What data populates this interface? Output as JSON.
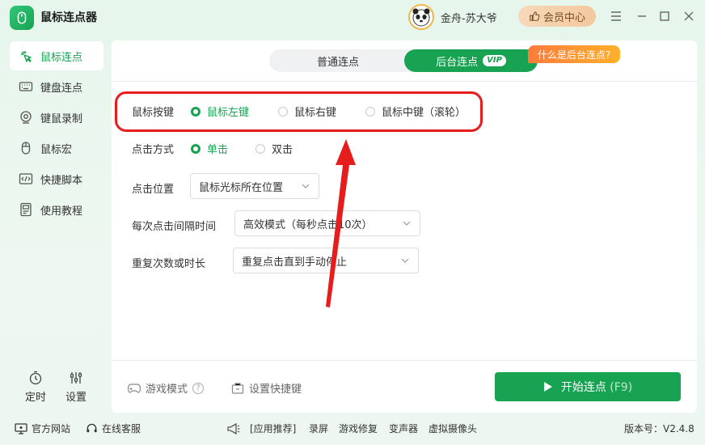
{
  "app": {
    "title": "鼠标连点器",
    "username": "金舟-苏大爷",
    "member_label": "会员中心"
  },
  "sidebar": {
    "items": [
      {
        "label": "鼠标连点",
        "icon": "click-icon",
        "active": true
      },
      {
        "label": "键盘连点",
        "icon": "keyboard-icon"
      },
      {
        "label": "键鼠录制",
        "icon": "record-icon"
      },
      {
        "label": "鼠标宏",
        "icon": "mouse-icon"
      },
      {
        "label": "快捷脚本",
        "icon": "script-icon"
      },
      {
        "label": "使用教程",
        "icon": "tutorial-icon"
      }
    ],
    "timer_label": "定时",
    "settings_label": "设置"
  },
  "tabs": {
    "normal": "普通连点",
    "background": "后台连点",
    "vip_badge": "VIP",
    "tip": "什么是后台连点?"
  },
  "form": {
    "mouse_button": {
      "label": "鼠标按键",
      "options": [
        "鼠标左键",
        "鼠标右键",
        "鼠标中键（滚轮）"
      ],
      "selected": 0
    },
    "click_mode": {
      "label": "点击方式",
      "options": [
        "单击",
        "双击"
      ],
      "selected": 0
    },
    "click_position": {
      "label": "点击位置",
      "value": "鼠标光标所在位置"
    },
    "interval": {
      "label": "每次点击间隔时间",
      "value": "高效模式（每秒点击10次）"
    },
    "repeat": {
      "label": "重复次数或时长",
      "value": "重复点击直到手动停止"
    }
  },
  "bottom": {
    "game_mode": "游戏模式",
    "help": "?",
    "shortcut": "设置快捷键",
    "start": "开始连点",
    "start_key": "(F9)"
  },
  "footer": {
    "website": "官方网站",
    "support": "在线客服",
    "recommend": "[应用推荐]",
    "links": [
      "录屏",
      "游戏修复",
      "变声器",
      "虚拟摄像头"
    ],
    "version": "版本号：V2.4.8"
  },
  "colors": {
    "accent": "#17a352",
    "highlight": "#e71c1c",
    "tip": "#ff8a30"
  }
}
